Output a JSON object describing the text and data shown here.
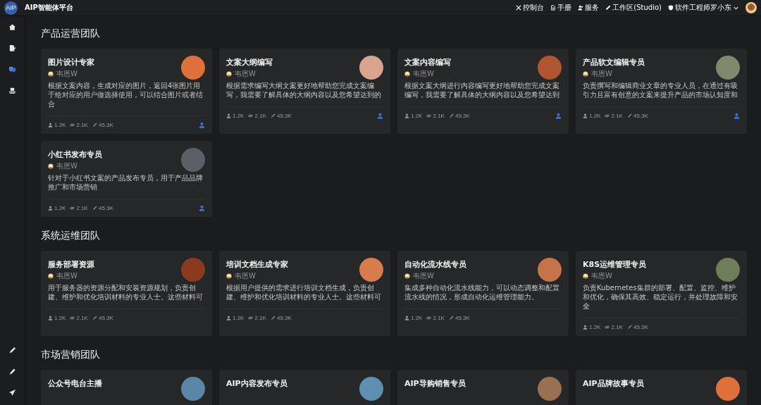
{
  "header": {
    "logo": "AIP",
    "title": "AIP智能体平台",
    "nav": [
      "控制台",
      "手册",
      "服务",
      "工作区(Studio)"
    ],
    "user": "软件工程师罗小东"
  },
  "sidebar": {
    "top_items": [
      {
        "selected": false
      },
      {
        "selected": false
      },
      {
        "selected": true
      },
      {
        "selected": false
      }
    ],
    "bottom_items": [
      {
        "selected": false
      },
      {
        "selected": false
      },
      {
        "selected": false
      }
    ]
  },
  "sections": [
    {
      "title": "产品运营团队",
      "cards": [
        {
          "title": "图片设计专家",
          "author": "韦恩W",
          "description": "根据文案内容，生成对应的图片，返回4张图片用于给对应的用户做选择使用，可以结合图片或者结合",
          "stats": [
            "1.2K",
            "2.1K",
            "45.3K"
          ],
          "subscribed": true
        },
        {
          "title": "文案大纲编写",
          "author": "韦恩W",
          "description": "根据需求编写大纲文案更好地帮助您完成文案编写，我需要了解具体的大纲内容以及您希望达到的",
          "stats": [
            "1.2K",
            "2.1K",
            "45.3K"
          ],
          "subscribed": true
        },
        {
          "title": "文案内容编写",
          "author": "韦恩W",
          "description": "根据文案大纲进行内容编写更好地帮助您完成文案编写，我需要了解具体的大纲内容以及您希望达到",
          "stats": [
            "1.2K",
            "2.1K",
            "45.3K"
          ],
          "subscribed": true
        },
        {
          "title": "产品软文编辑专员",
          "author": "韦恩W",
          "description": "负责撰写和编辑商业文章的专业人员，在通过有吸引力且富有创意的文案来提升产品的市场认知度和",
          "stats": [
            "1.2K",
            "2.1K",
            "45.3K"
          ],
          "subscribed": true
        },
        {
          "title": "小红书发布专员",
          "author": "韦恩W",
          "description": "针对于小红书文案的产品发布专员，用于产品品牌推广和市场营销",
          "stats": [
            "1.2K",
            "2.1K",
            "45.3K"
          ],
          "subscribed": true
        }
      ]
    },
    {
      "title": "系统运维团队",
      "cards": [
        {
          "title": "服务部署资源",
          "author": "韦恩W",
          "description": "用于服务器的资源分配和安装资源规划，负责创建、维护和优化培训材料的专业人士。这些材料可",
          "stats": [
            "1.2K",
            "2.1K",
            "45.3K"
          ],
          "subscribed": false
        },
        {
          "title": "培训文档生成专家",
          "author": "韦恩W",
          "description": "根据用户提供的需求进行培训文档生成，负责创建、维护和优化培训材料的专业人士。这些材料可",
          "stats": [
            "1.2K",
            "2.1K",
            "45.3K"
          ],
          "subscribed": false
        },
        {
          "title": "自动化流水线专员",
          "author": "韦恩W",
          "description": "集成多种自动化流水线能力，可以动态调整和配置流水线的情况，形成自动化运维管理能力。",
          "stats": [
            "1.2K",
            "2.1K",
            "45.3K"
          ],
          "subscribed": false
        },
        {
          "title": "K8S运维管理专员",
          "author": "韦恩W",
          "description": "负责Kubernetes集群的部署、配置、监控、维护和优化，确保其高效、稳定运行，并处理故障和安全",
          "stats": [
            "1.2K",
            "2.1K",
            "45.3K"
          ],
          "subscribed": false
        }
      ]
    },
    {
      "title": "市场营销团队",
      "cards": [
        {
          "title": "公众号电台主播"
        },
        {
          "title": "AIP内容发布专员"
        },
        {
          "title": "AIP导购销售专员"
        },
        {
          "title": "AIP品牌故事专员"
        }
      ]
    }
  ]
}
